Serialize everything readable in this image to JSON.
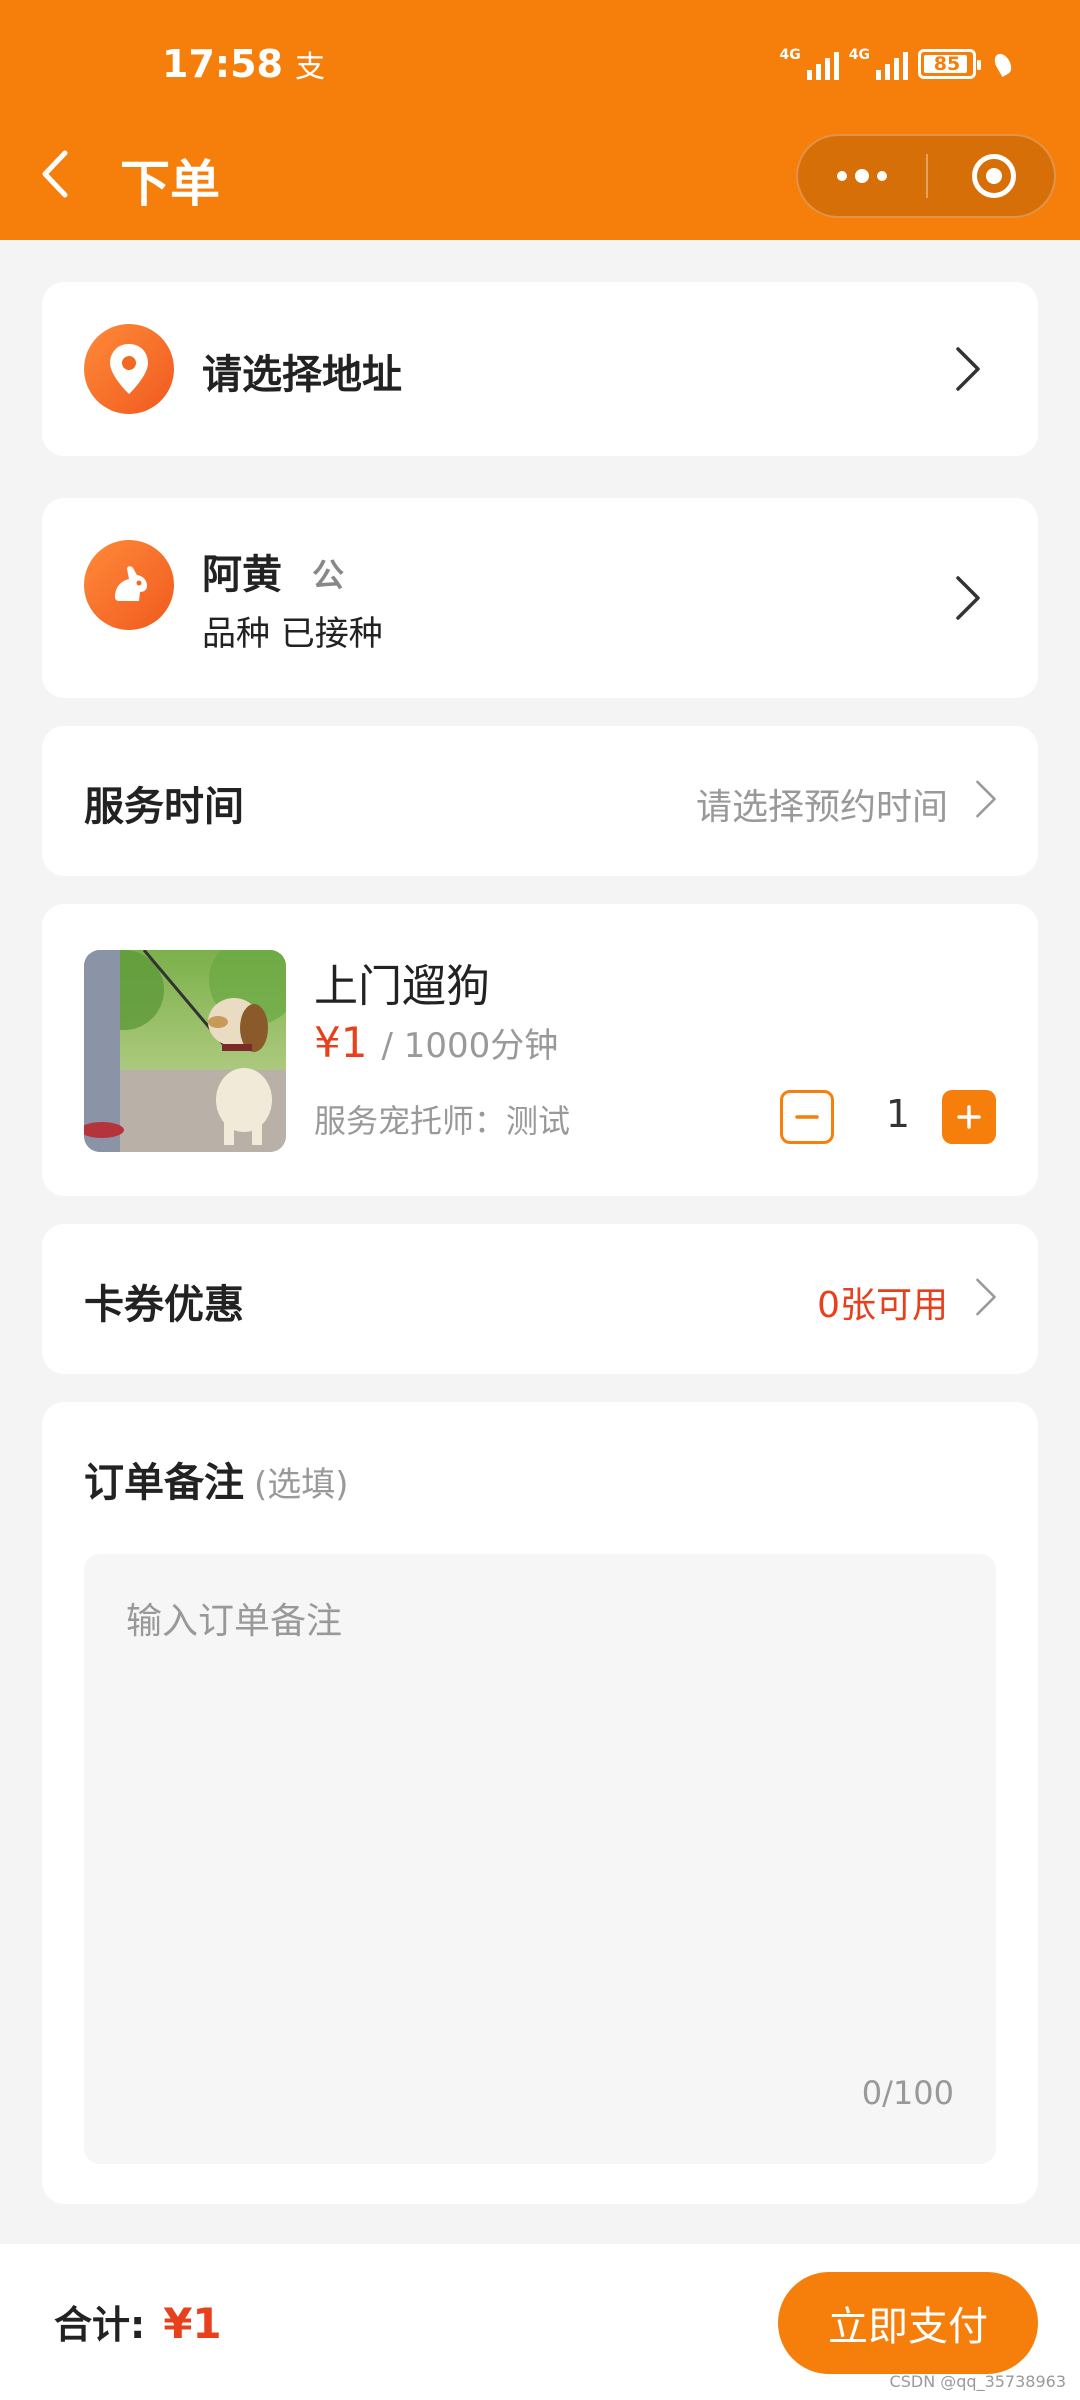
{
  "status_bar": {
    "time": "17:58",
    "alipay_glyph": "支",
    "net1": "4G",
    "net2": "4G",
    "battery": "85"
  },
  "header": {
    "back_icon": "chevron-left-icon",
    "title": "下单",
    "more_icon": "more-dots-icon",
    "close_icon": "target-circle-icon"
  },
  "address": {
    "icon": "location-pin-icon",
    "label": "请选择地址"
  },
  "pet": {
    "icon": "dog-icon",
    "name": "阿黄",
    "gender": "公",
    "details": "品种 已接种"
  },
  "service_time": {
    "label": "服务时间",
    "placeholder": "请选择预约时间"
  },
  "service": {
    "image": "dog-walking-photo",
    "title": "上门遛狗",
    "price": "¥1",
    "unit": "/ 1000分钟",
    "sitter": "服务宠托师：测试",
    "quantity": "1"
  },
  "coupon": {
    "label": "卡券优惠",
    "value": "0张可用"
  },
  "remark": {
    "title": "订单备注",
    "optional": "(选填)",
    "placeholder": "输入订单备注",
    "counter": "0/100"
  },
  "footer": {
    "total_label": "合计:",
    "total": "¥1",
    "pay_button": "立即支付"
  },
  "watermark": "CSDN @qq_35738963",
  "colors": {
    "brand": "#f57f0a",
    "price": "#e8401c",
    "background": "#f4f4f4"
  }
}
